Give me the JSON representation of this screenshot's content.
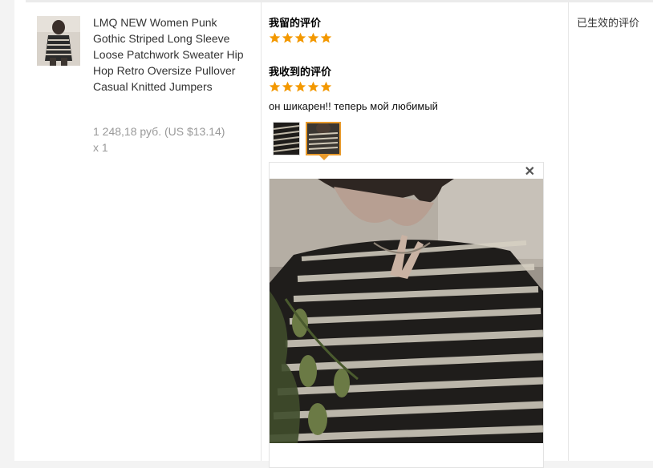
{
  "product": {
    "title": "LMQ NEW Women Punk Gothic Striped Long Sleeve Loose Patchwork Sweater Hip Hop Retro Oversize Pullover Casual Knitted Jumpers",
    "price": "1 248,18 руб. (US $13.14)",
    "quantity": "x 1"
  },
  "my_review": {
    "title": "我留的评价",
    "rating": 5
  },
  "received_review": {
    "title": "我收到的评价",
    "rating": 5,
    "text": "он шикарен!! теперь мой любимый",
    "photo_count": 2,
    "selected_photo": 2
  },
  "status": {
    "label": "已生效的评价"
  },
  "icons": {
    "star": "star-icon",
    "close": "close-icon"
  },
  "colors": {
    "star": "#f39800",
    "selected_border": "#e89a2c"
  }
}
